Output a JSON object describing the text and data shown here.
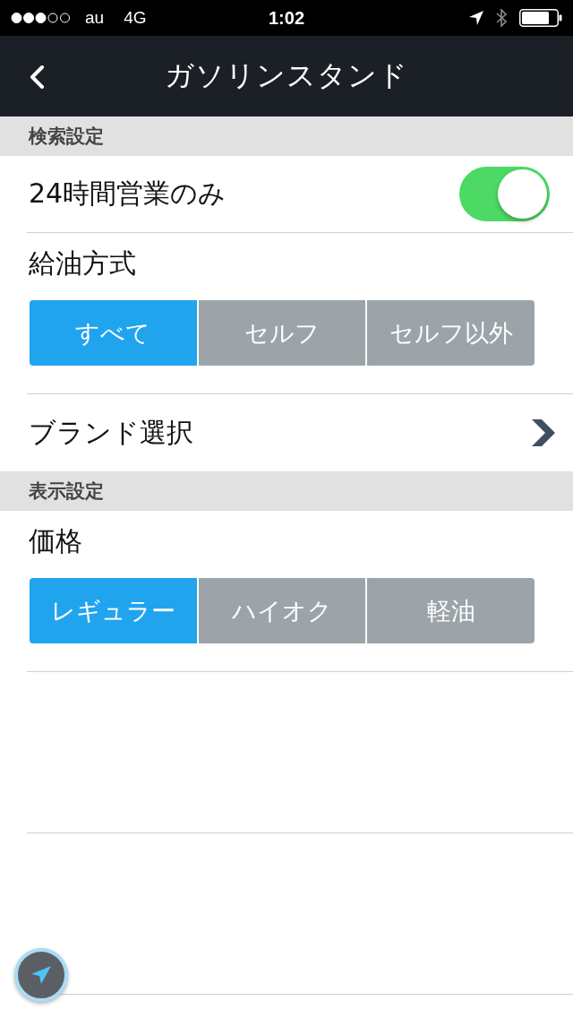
{
  "status_bar": {
    "carrier": "au",
    "network": "4G",
    "time": "1:02"
  },
  "nav": {
    "title": "ガソリンスタンド"
  },
  "sections": [
    {
      "header": "検索設定",
      "rows": [
        {
          "kind": "toggle",
          "label": "24時間営業のみ",
          "on": true
        },
        {
          "kind": "segmented",
          "label": "給油方式",
          "options": [
            {
              "label": "すべて",
              "selected": true
            },
            {
              "label": "セルフ",
              "selected": false
            },
            {
              "label": "セルフ以外",
              "selected": false
            }
          ]
        },
        {
          "kind": "link",
          "label": "ブランド選択"
        }
      ]
    },
    {
      "header": "表示設定",
      "rows": [
        {
          "kind": "segmented",
          "label": "価格",
          "options": [
            {
              "label": "レギュラー",
              "selected": true
            },
            {
              "label": "ハイオク",
              "selected": false
            },
            {
              "label": "軽油",
              "selected": false
            }
          ]
        }
      ]
    }
  ]
}
